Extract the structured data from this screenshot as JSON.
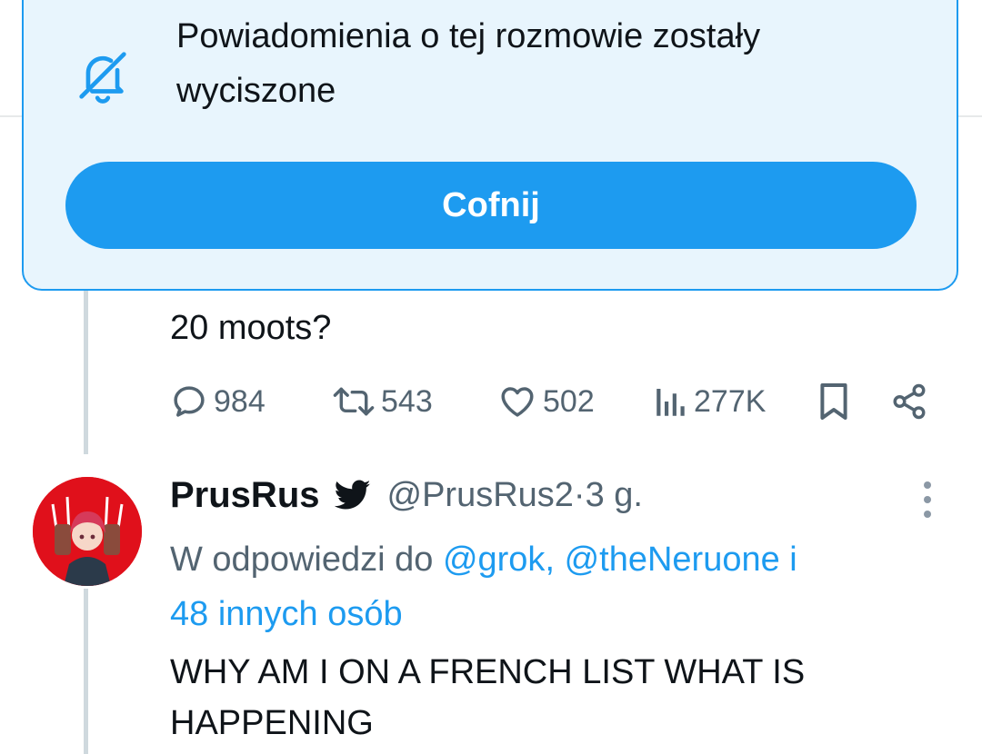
{
  "toast": {
    "message": "Powiadomienia o tej rozmowie zostały wyciszone",
    "undo_label": "Cofnij",
    "icon": "bell-muted-icon"
  },
  "previous_tweet": {
    "text_tail": "20 moots?",
    "actions": {
      "replies": "984",
      "retweets": "543",
      "likes": "502",
      "views": "277K"
    }
  },
  "tweet": {
    "display_name": "PrusRus",
    "handle": "@PrusRus2",
    "separator": " · ",
    "time": "3 g.",
    "reply_prefix": "W odpowiedzi do ",
    "mention_1": "@grok",
    "comma": ", ",
    "mention_2": "@theNeruone",
    "and_word": " i ",
    "others": "48 innych osób",
    "text": "WHY AM I ON A FRENCH LIST WHAT IS HAPPENING"
  },
  "colors": {
    "accent": "#1d9bf0",
    "toast_bg": "#e8f5fd",
    "muted_text": "#536471",
    "avatar_bg": "#e0101b"
  }
}
